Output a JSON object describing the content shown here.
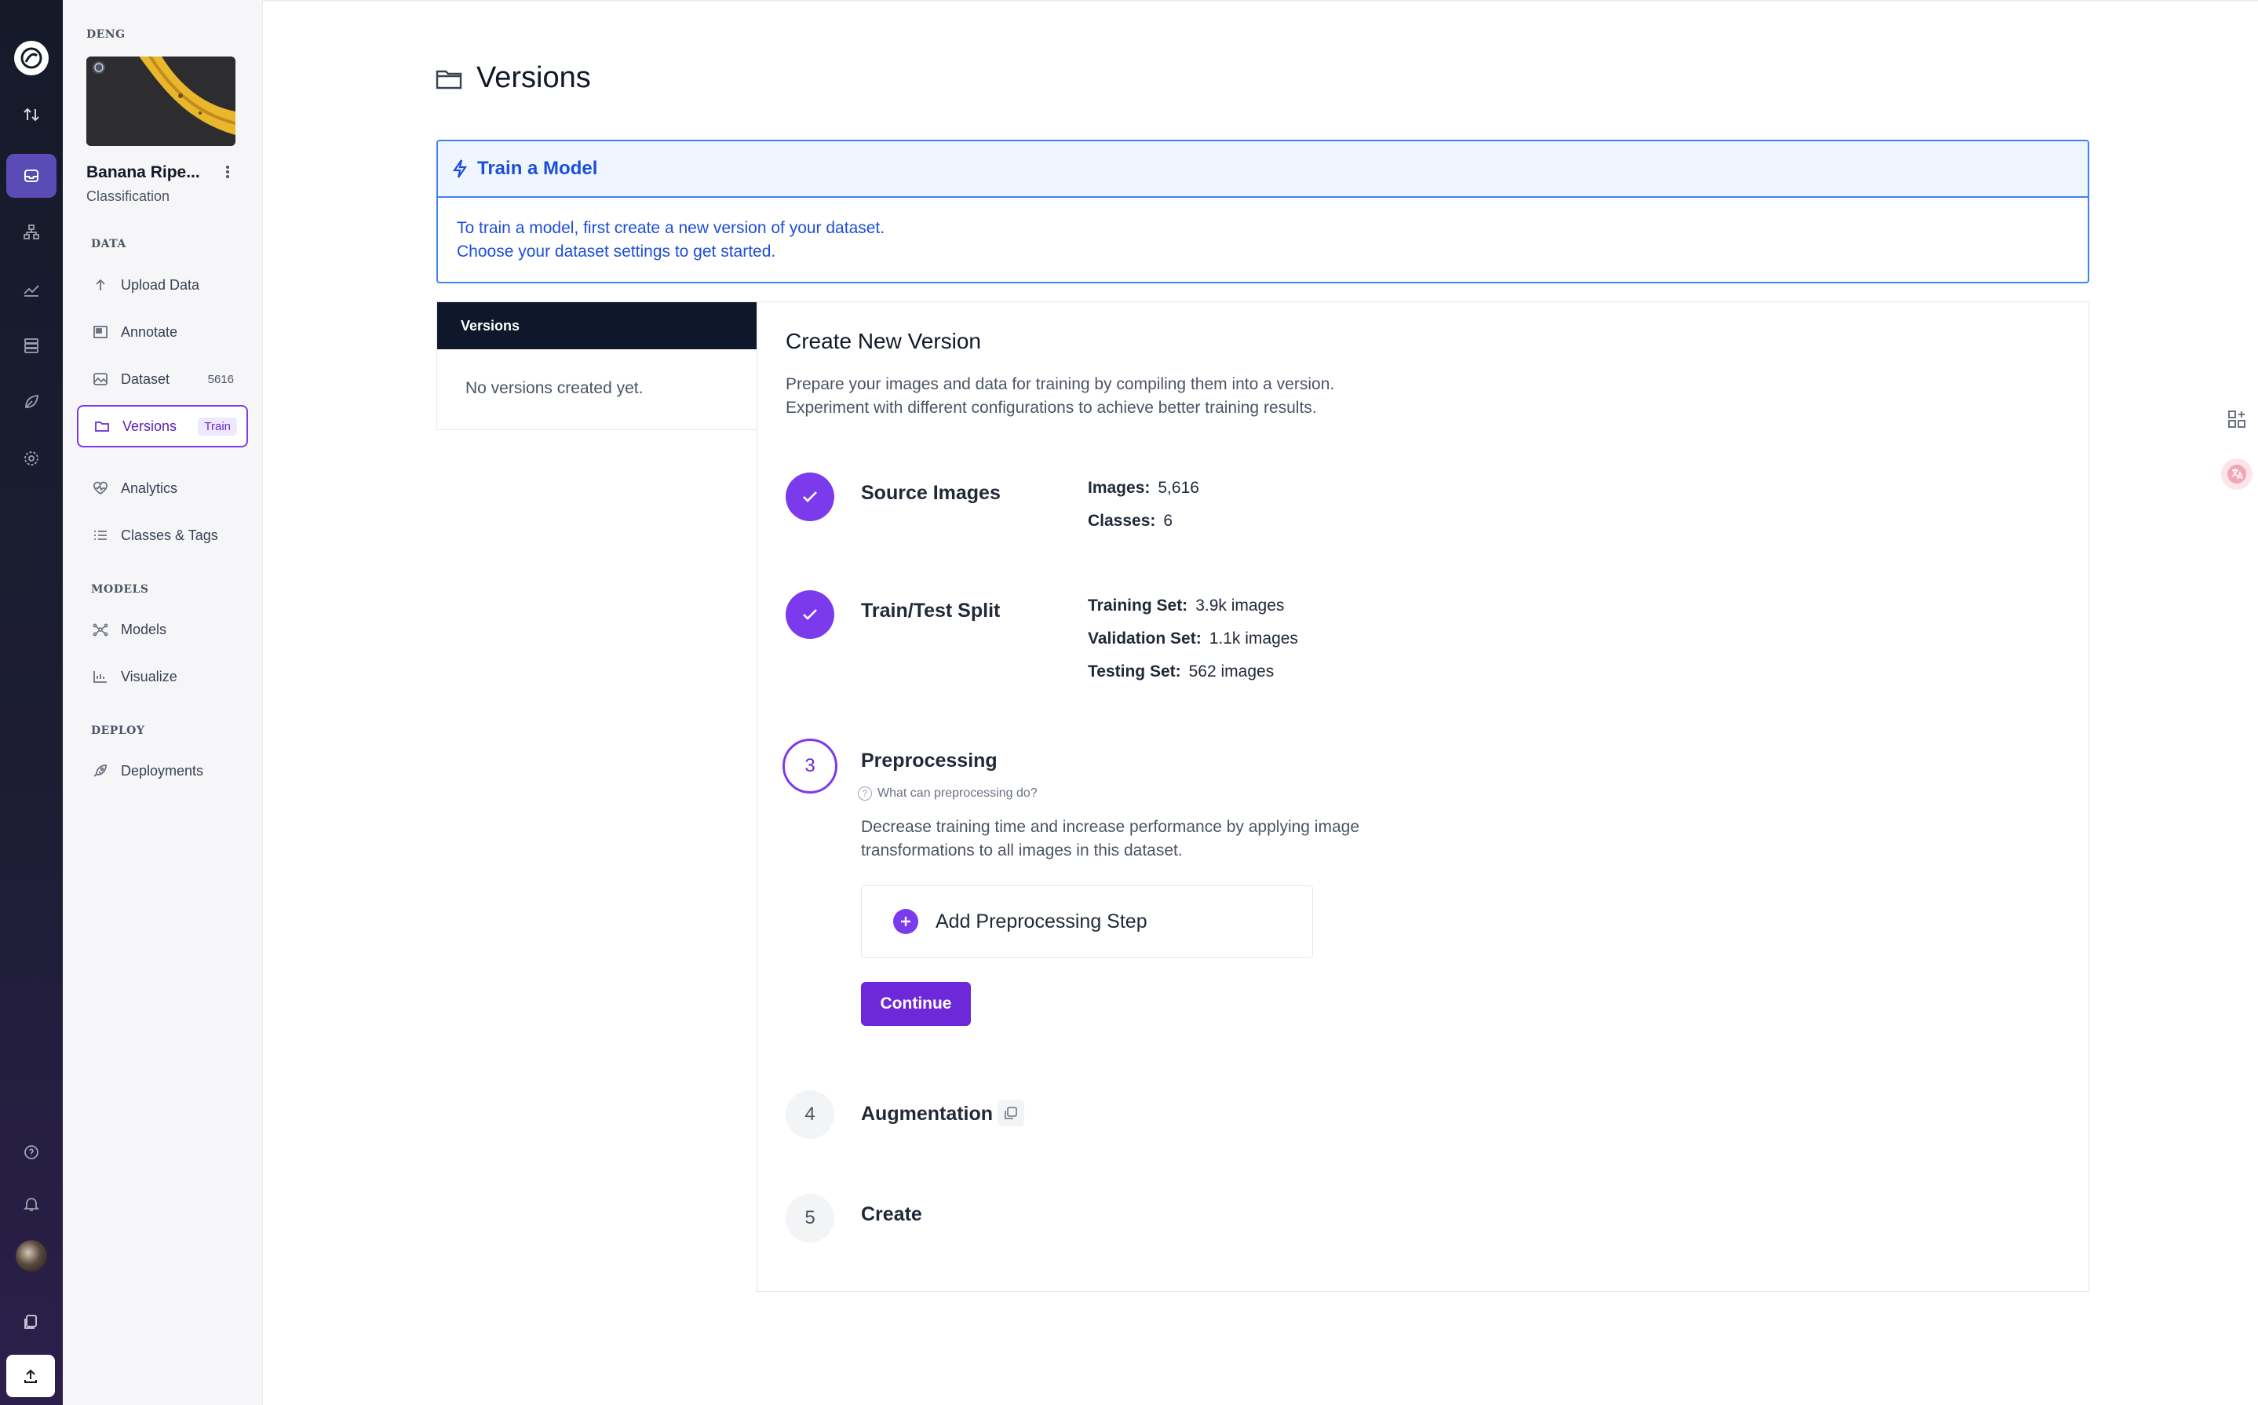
{
  "workspace": {
    "name": "DENG"
  },
  "project": {
    "name": "Banana Ripe...",
    "type": "Classification"
  },
  "sidebar": {
    "sections": {
      "data": "DATA",
      "models": "MODELS",
      "deploy": "DEPLOY"
    },
    "items": {
      "upload": {
        "label": "Upload Data",
        "icon": "upload-icon"
      },
      "annotate": {
        "label": "Annotate",
        "icon": "annotate-icon"
      },
      "dataset": {
        "label": "Dataset",
        "badge": "5616",
        "icon": "image-icon"
      },
      "versions": {
        "label": "Versions",
        "pill": "Train",
        "icon": "folder-icon"
      },
      "analytics": {
        "label": "Analytics",
        "icon": "heart-pulse-icon"
      },
      "classes": {
        "label": "Classes & Tags",
        "icon": "list-icon"
      },
      "models": {
        "label": "Models",
        "icon": "network-icon"
      },
      "visualize": {
        "label": "Visualize",
        "icon": "chart-icon"
      },
      "deployments": {
        "label": "Deployments",
        "icon": "rocket-icon"
      }
    }
  },
  "page": {
    "title": "Versions"
  },
  "alert": {
    "title": "Train a Model",
    "line1": "To train a model, first create a new version of your dataset.",
    "line2": "Choose your dataset settings to get started."
  },
  "versions_list": {
    "header": "Versions",
    "empty": "No versions created yet."
  },
  "create": {
    "title": "Create New Version",
    "desc1": "Prepare your images and data for training by compiling them into a version.",
    "desc2": "Experiment with different configurations to achieve better training results."
  },
  "steps": {
    "source": {
      "title": "Source Images",
      "images_label": "Images:",
      "images_value": "5,616",
      "classes_label": "Classes:",
      "classes_value": "6"
    },
    "split": {
      "title": "Train/Test Split",
      "train_label": "Training Set:",
      "train_value": "3.9k images",
      "valid_label": "Validation Set:",
      "valid_value": "1.1k images",
      "test_label": "Testing Set:",
      "test_value": "562 images"
    },
    "preprocessing": {
      "number": "3",
      "title": "Preprocessing",
      "help": "What can preprocessing do?",
      "desc1": "Decrease training time and increase performance by applying image",
      "desc2": "transformations to all images in this dataset.",
      "add_label": "Add Preprocessing Step",
      "continue_label": "Continue"
    },
    "augmentation": {
      "number": "4",
      "title": "Augmentation"
    },
    "create": {
      "number": "5",
      "title": "Create"
    }
  },
  "colors": {
    "accent": "#7c3aed",
    "info": "#1d4ed8",
    "rail": "#151a29"
  }
}
